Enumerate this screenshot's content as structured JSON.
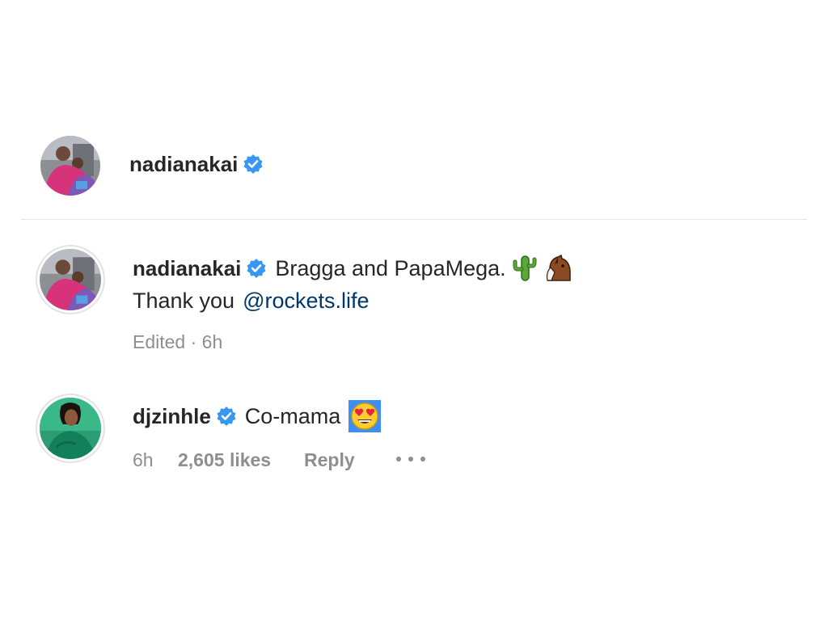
{
  "post_header": {
    "username": "nadianakai",
    "verified_icon": "verified-badge-icon"
  },
  "caption": {
    "username": "nadianakai",
    "text": "Bragga and PapaMega.",
    "emojis": [
      "cactus-emoji",
      "horse-emoji"
    ],
    "text_line2": "Thank you",
    "mention": "@rockets.life",
    "meta": "Edited · 6h"
  },
  "comment": {
    "username": "djzinhle",
    "text": "Co-mama",
    "emoji": "heart-eyes-emoji",
    "time": "6h",
    "likes": "2,605 likes",
    "reply_label": "Reply",
    "more_icon": "more-options-icon"
  },
  "colors": {
    "verified": "#3897f0",
    "mention": "#00376b",
    "meta": "#8e8e8e",
    "divider": "#e6e6e6"
  }
}
